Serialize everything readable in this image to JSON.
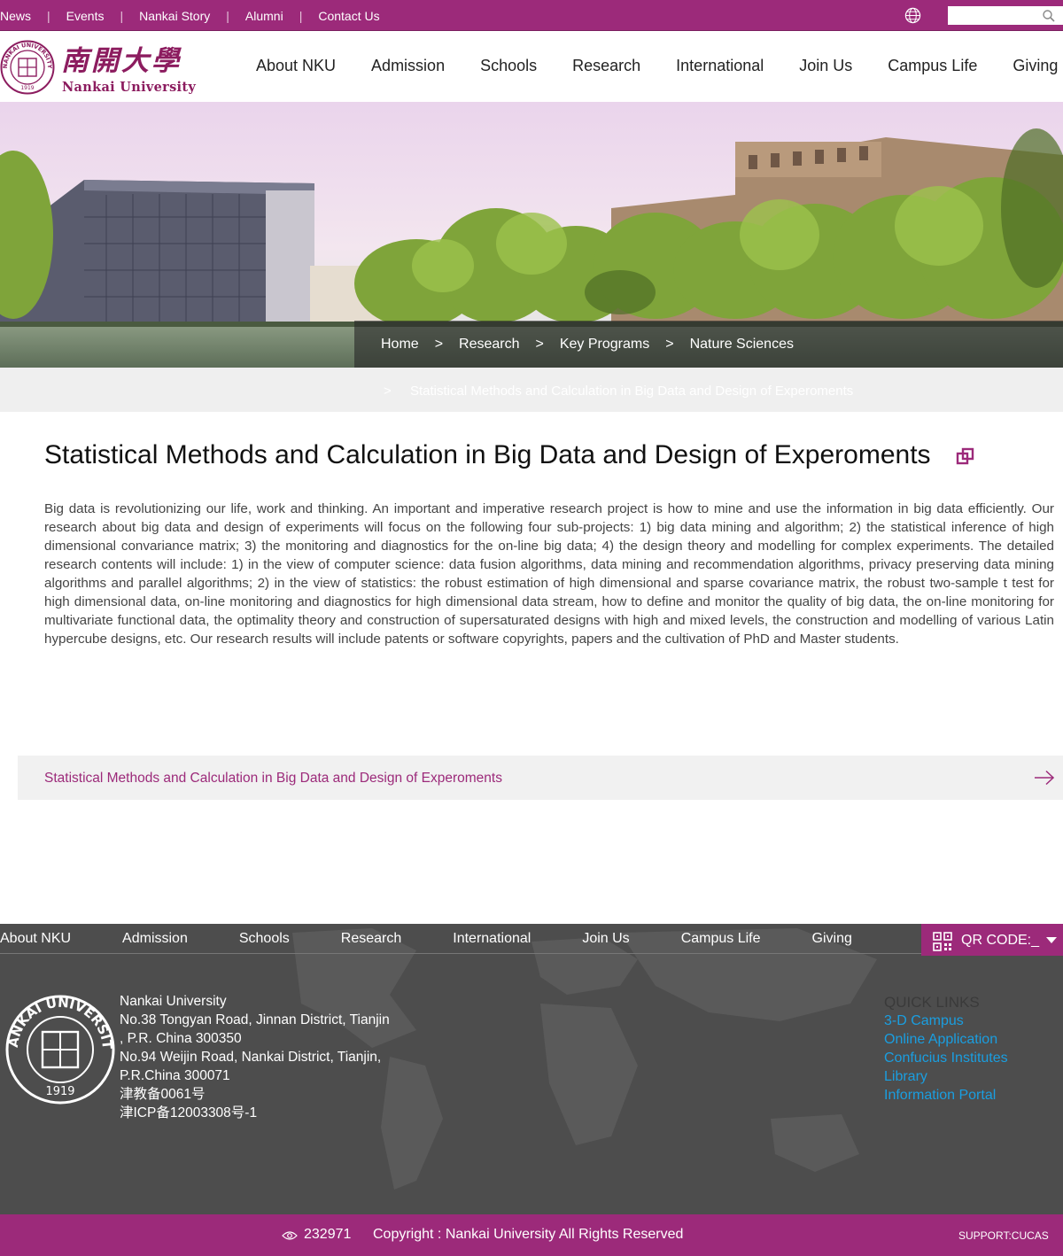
{
  "topbar": {
    "links": [
      "News",
      "Events",
      "Nankai Story",
      "Alumni",
      "Contact Us"
    ],
    "separator": "|",
    "search_placeholder": ""
  },
  "header": {
    "logo_cn": "南開大學",
    "logo_en": "Nankai University",
    "seal_text": "NANKAI UNIVERSITY",
    "seal_year": "1919",
    "nav": [
      "About NKU",
      "Admission",
      "Schools",
      "Research",
      "International",
      "Join Us",
      "Campus Life",
      "Giving"
    ]
  },
  "breadcrumb": {
    "items": [
      "Home",
      "Research",
      "Key Programs",
      "Nature Sciences"
    ],
    "separator": ">",
    "current": "Statistical Methods and Calculation in Big Data and Design of Experoments"
  },
  "article": {
    "title": "Statistical Methods and Calculation in Big Data and Design of Experoments",
    "body": "Big data is revolutionizing our life, work and thinking. An important and imperative research project is how to mine and use the information in big data efficiently. Our research about big data and design of experiments will focus on the following four sub-projects: 1) big data mining and algorithm; 2) the statistical inference of high dimensional convariance matrix; 3) the monitoring and diagnostics for the on-line big data; 4) the design theory and modelling for complex experiments. The detailed research contents will include: 1) in the view of computer science: data fusion algorithms, data mining and recommendation algorithms, privacy preserving data mining algorithms and parallel algorithms; 2) in the view of statistics: the robust estimation of high dimensional and sparse covariance matrix, the robust two-sample t test for high dimensional data, on-line monitoring and diagnostics for high dimensional data stream, how to define and monitor the quality of big data, the on-line monitoring for multivariate functional data, the optimality theory and construction of supersaturated designs with high and mixed levels, the construction and modelling of various Latin hypercube designs, etc. Our research results will include patents or software copyrights, papers and the cultivation of PhD and Master students.",
    "related_link": "Statistical Methods and Calculation in Big Data and Design of Experoments"
  },
  "footer": {
    "nav": [
      "About NKU",
      "Admission",
      "Schools",
      "Research",
      "International",
      "Join Us",
      "Campus Life",
      "Giving"
    ],
    "qr_label": "QR CODE:_",
    "seal_text": "NANKAI UNIVERSITY",
    "seal_year": "1919",
    "address": [
      "Nankai University",
      "No.38 Tongyan Road, Jinnan District, Tianjin",
      ", P.R. China 300350",
      "No.94 Weijin Road,  Nankai District, Tianjin,",
      "P.R.China  300071",
      "津教备0061号",
      "津ICP备12003308号-1"
    ],
    "quick_links_title": "QUICK LINKS",
    "quick_links": [
      "3-D Campus",
      "Online Application",
      "Confucius Institutes",
      "Library",
      "Information Portal"
    ],
    "link_color": "#1a9ee0"
  },
  "bottombar": {
    "visits": "232971",
    "copyright": "Copyright : Nankai University All Rights Reserved",
    "support": "SUPPORT:CUCAS"
  },
  "colors": {
    "brand": "#9c2a7a",
    "footer_bg": "#4d4d4d"
  }
}
